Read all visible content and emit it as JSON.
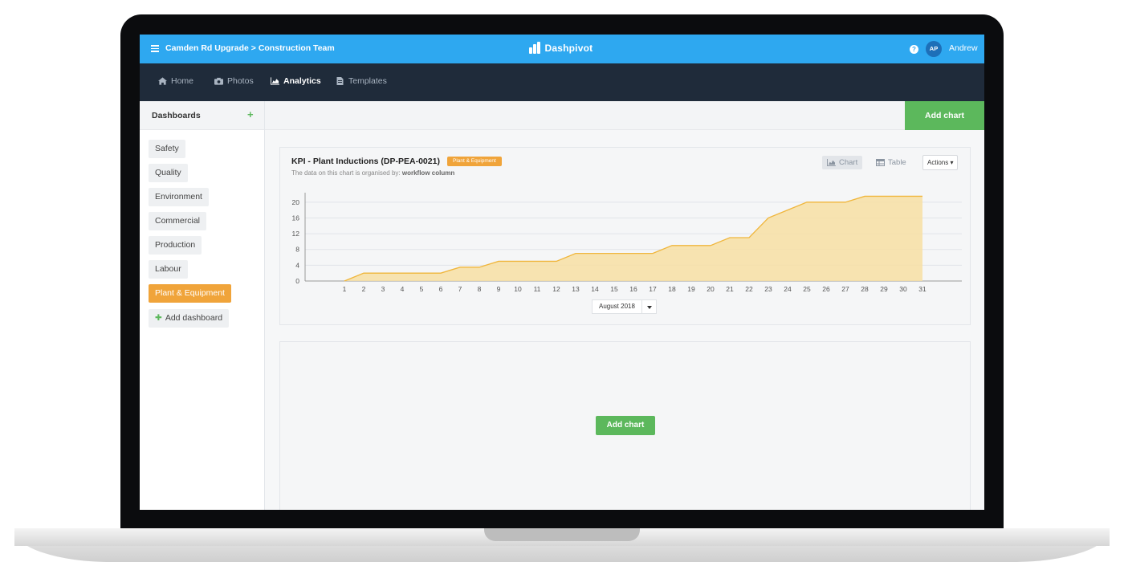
{
  "topbar": {
    "breadcrumb": "Camden Rd Upgrade > Construction Team",
    "app_name": "Dashpivot",
    "avatar_initials": "AP",
    "username": "Andrew",
    "color": "#2ea8f0"
  },
  "nav": {
    "items": [
      {
        "label": "Home",
        "icon": "home-icon",
        "active": false
      },
      {
        "label": "Photos",
        "icon": "camera-icon",
        "active": false
      },
      {
        "label": "Analytics",
        "icon": "area-chart-icon",
        "active": true
      },
      {
        "label": "Templates",
        "icon": "document-icon",
        "active": false
      }
    ]
  },
  "sidebar": {
    "title": "Dashboards",
    "add_symbol": "+",
    "items": [
      {
        "label": "Safety"
      },
      {
        "label": "Quality"
      },
      {
        "label": "Environment"
      },
      {
        "label": "Commercial"
      },
      {
        "label": "Production"
      },
      {
        "label": "Labour"
      },
      {
        "label": "Plant & Equipment",
        "active": true
      }
    ],
    "add_dashboard_label": "Add dashboard",
    "accent_color": "#f0a43a"
  },
  "main": {
    "add_chart_label": "Add chart",
    "card": {
      "title": "KPI - Plant Inductions (DP-PEA-0021)",
      "badge": "Plant & Equipment",
      "subtitle_prefix": "The data on this chart is organised by:",
      "subtitle_value": "workflow column",
      "chart_toggle": "Chart",
      "table_toggle": "Table",
      "actions_label": "Actions",
      "month_picker": "August 2018"
    },
    "empty_card": {
      "add_chart_label": "Add chart"
    }
  },
  "chart_data": {
    "type": "area",
    "x": [
      1,
      2,
      3,
      4,
      5,
      6,
      7,
      8,
      9,
      10,
      11,
      12,
      13,
      14,
      15,
      16,
      17,
      18,
      19,
      20,
      21,
      22,
      23,
      24,
      25,
      26,
      27,
      28,
      29,
      30,
      31
    ],
    "series": [
      {
        "values": [
          0,
          2,
          2,
          2,
          2,
          2,
          3.5,
          3.5,
          5,
          5,
          5,
          5,
          7,
          7,
          7,
          7,
          7,
          9,
          9,
          9,
          11,
          11,
          16,
          18,
          20,
          20,
          20,
          21.5,
          21.5,
          21.5,
          21.5
        ],
        "color": "#f0b63c"
      }
    ],
    "yticks": [
      0,
      4,
      8,
      12,
      16,
      20
    ],
    "ylim": [
      0,
      22
    ],
    "grid": true
  }
}
